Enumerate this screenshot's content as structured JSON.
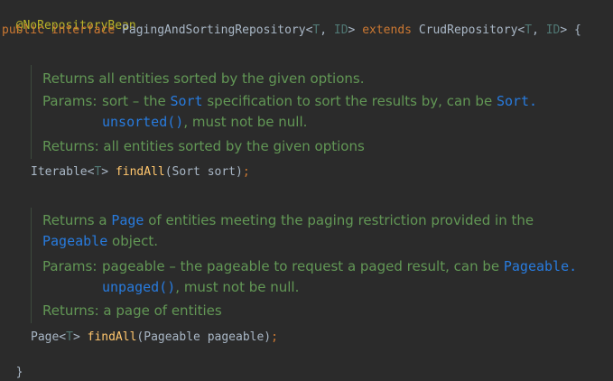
{
  "code": {
    "annotation": "@NoRepositoryBean",
    "decl": {
      "public": "public",
      "interface": "interface",
      "name": "PagingAndSortingRepository<",
      "t1": "T",
      "sep1": ", ",
      "id1": "ID",
      "close1": ">",
      "extends": "extends",
      "parent": "CrudRepository<",
      "t2": "T",
      "sep2": ", ",
      "id2": "ID",
      "close2": "> {"
    },
    "method1": {
      "ret_a": "Iterable<",
      "ret_t": "T",
      "ret_b": "> ",
      "name": "findAll",
      "args": "(Sort sort)",
      "semi": ";"
    },
    "method2": {
      "ret_a": "Page<",
      "ret_t": "T",
      "ret_b": "> ",
      "name": "findAll",
      "args": "(Pageable pageable)",
      "semi": ";"
    },
    "close_brace": "}"
  },
  "doc1": {
    "summary": "Returns all entities sorted by the given options.",
    "params_label": "Params:",
    "param_a": "sort – the ",
    "param_code1": "Sort",
    "param_b": " specification to sort the results by, can be ",
    "param_code2": "Sort.",
    "param_code3": "unsorted()",
    "param_c": ", must not be null.",
    "returns": "Returns: all entities sorted by the given options"
  },
  "doc2": {
    "summary_a": "Returns a ",
    "summary_code1": "Page",
    "summary_b": " of entities meeting the paging restriction provided in the",
    "summary_code2": "Pageable",
    "summary_c": " object.",
    "params_label": "Params:",
    "param_a": "pageable – the pageable to request a paged result, can be ",
    "param_code1": "Pageable.",
    "param_code2": "unpaged()",
    "param_b": ", must not be null.",
    "returns": "Returns: a page of entities"
  }
}
